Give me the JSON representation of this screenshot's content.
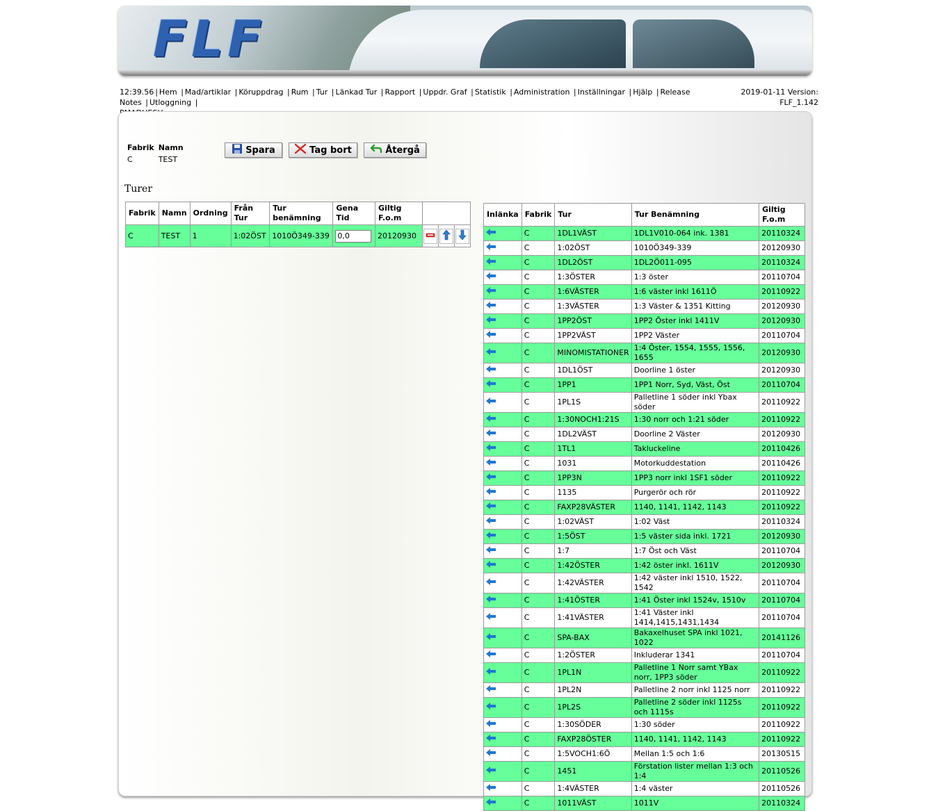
{
  "header": {
    "logo": "FLF"
  },
  "menu": {
    "time": "12:39.56",
    "items": [
      "Hem",
      "Mad/artiklar",
      "Köruppdrag",
      "Rum",
      "Tur",
      "Länkad Tur",
      "Rapport",
      "Uppdr. Graf",
      "Statistik",
      "Administration",
      "Inställningar",
      "Hjälp",
      "Release Notes",
      "Utloggning"
    ],
    "user": "PMADHESH",
    "date_version": "2019-01-11 Version:",
    "version": "FLF_1.142"
  },
  "info": {
    "fabrik_label": "Fabrik",
    "namn_label": "Namn",
    "fabrik": "C",
    "namn": "TEST"
  },
  "buttons": {
    "spara": "Spara",
    "tag_bort": "Tag bort",
    "atergå": "Återgå"
  },
  "turer_title": "Turer",
  "left_table": {
    "headers": [
      "Fabrik",
      "Namn",
      "Ordning",
      "Från Tur",
      "Tur benämning",
      "Gena Tid",
      "Giltig F.o.m"
    ],
    "row": {
      "fabrik": "C",
      "namn": "TEST",
      "ordning": "1",
      "fran_tur": "1:02ÖST",
      "tur_benamning": "1010Ö349-339",
      "gena_tid": "0,0",
      "giltig": "20120930"
    }
  },
  "right_table": {
    "headers": [
      "Inlänka",
      "Fabrik",
      "Tur",
      "Tur Benämning",
      "Giltig F.o.m"
    ],
    "rows": [
      {
        "fabrik": "C",
        "tur": "1DL1VÄST",
        "benamning": "1DL1V010-064 ink. 1381",
        "giltig": "20110324"
      },
      {
        "fabrik": "C",
        "tur": "1:02ÖST",
        "benamning": "1010Ö349-339",
        "giltig": "20120930"
      },
      {
        "fabrik": "C",
        "tur": "1DL2ÖST",
        "benamning": "1DL2Ö011-095",
        "giltig": "20110324"
      },
      {
        "fabrik": "C",
        "tur": "1:3ÖSTER",
        "benamning": "1:3 öster",
        "giltig": "20110704"
      },
      {
        "fabrik": "C",
        "tur": "1:6VÄSTER",
        "benamning": "1:6 väster inkl 1611Ö",
        "giltig": "20110922"
      },
      {
        "fabrik": "C",
        "tur": "1:3VÄSTER",
        "benamning": "1:3 Väster & 1351 Kitting",
        "giltig": "20120930"
      },
      {
        "fabrik": "C",
        "tur": "1PP2ÖST",
        "benamning": "1PP2 Öster inkl 1411V",
        "giltig": "20120930"
      },
      {
        "fabrik": "C",
        "tur": "1PP2VÄST",
        "benamning": "1PP2 Väster",
        "giltig": "20110704"
      },
      {
        "fabrik": "C",
        "tur": "MINOMISTATIONER",
        "benamning": "1:4 Öster, 1554, 1555, 1556, 1655",
        "giltig": "20120930"
      },
      {
        "fabrik": "C",
        "tur": "1DL1ÖST",
        "benamning": "Doorline 1 öster",
        "giltig": "20120930"
      },
      {
        "fabrik": "C",
        "tur": "1PP1",
        "benamning": "1PP1 Norr, Syd, Väst, Öst",
        "giltig": "20110704"
      },
      {
        "fabrik": "C",
        "tur": "1PL1S",
        "benamning": "Palletline 1 söder inkl Ybax söder",
        "giltig": "20110922"
      },
      {
        "fabrik": "C",
        "tur": "1:30NOCH1:21S",
        "benamning": "1:30 norr och 1:21 söder",
        "giltig": "20110922"
      },
      {
        "fabrik": "C",
        "tur": "1DL2VÄST",
        "benamning": "Doorline 2 Väster",
        "giltig": "20120930"
      },
      {
        "fabrik": "C",
        "tur": "1TL1",
        "benamning": "Takluckeline",
        "giltig": "20110426"
      },
      {
        "fabrik": "C",
        "tur": "1031",
        "benamning": "Motorkuddestation",
        "giltig": "20110426"
      },
      {
        "fabrik": "C",
        "tur": "1PP3N",
        "benamning": "1PP3 norr inkl 1SF1 söder",
        "giltig": "20110922"
      },
      {
        "fabrik": "C",
        "tur": "1135",
        "benamning": "Purgerör och rör",
        "giltig": "20110922"
      },
      {
        "fabrik": "C",
        "tur": "FAXP28VÄSTER",
        "benamning": "1140, 1141, 1142, 1143",
        "giltig": "20110922"
      },
      {
        "fabrik": "C",
        "tur": "1:02VÄST",
        "benamning": "1:02 Väst",
        "giltig": "20110324"
      },
      {
        "fabrik": "C",
        "tur": "1:5ÖST",
        "benamning": "1:5 väster sida inkl. 1721",
        "giltig": "20120930"
      },
      {
        "fabrik": "C",
        "tur": "1:7",
        "benamning": "1:7 Öst och Väst",
        "giltig": "20110704"
      },
      {
        "fabrik": "C",
        "tur": "1:42ÖSTER",
        "benamning": "1:42 öster inkl. 1611V",
        "giltig": "20120930"
      },
      {
        "fabrik": "C",
        "tur": "1:42VÄSTER",
        "benamning": "1:42 väster inkl 1510, 1522, 1542",
        "giltig": "20110704"
      },
      {
        "fabrik": "C",
        "tur": "1:41ÖSTER",
        "benamning": "1:41 Öster inkl 1524v, 1510v",
        "giltig": "20110704"
      },
      {
        "fabrik": "C",
        "tur": "1:41VÄSTER",
        "benamning": "1:41 Väster inkl 1414,1415,1431,1434",
        "giltig": "20110704"
      },
      {
        "fabrik": "C",
        "tur": "SPA-BAX",
        "benamning": "Bakaxelhuset SPA inkl 1021, 1022",
        "giltig": "20141126"
      },
      {
        "fabrik": "C",
        "tur": "1:2ÖSTER",
        "benamning": "Inkluderar 1341",
        "giltig": "20110704"
      },
      {
        "fabrik": "C",
        "tur": "1PL1N",
        "benamning": "Palletline 1 Norr samt YBax norr, 1PP3 söder",
        "giltig": "20110922"
      },
      {
        "fabrik": "C",
        "tur": "1PL2N",
        "benamning": "Palletline 2 norr inkl 1125 norr",
        "giltig": "20110922"
      },
      {
        "fabrik": "C",
        "tur": "1PL2S",
        "benamning": "Palletline 2 söder inkl 1125s och 1115s",
        "giltig": "20110922"
      },
      {
        "fabrik": "C",
        "tur": "1:30SÖDER",
        "benamning": "1:30 söder",
        "giltig": "20110922"
      },
      {
        "fabrik": "C",
        "tur": "FAXP28ÖSTER",
        "benamning": "1140, 1141, 1142, 1143",
        "giltig": "20110922"
      },
      {
        "fabrik": "C",
        "tur": "1:5VOCH1:6Ö",
        "benamning": "Mellan 1:5 och 1:6",
        "giltig": "20130515"
      },
      {
        "fabrik": "C",
        "tur": "1451",
        "benamning": "Förstation lister mellan 1:3 och 1:4",
        "giltig": "20110526"
      },
      {
        "fabrik": "C",
        "tur": "1:4VÄSTER",
        "benamning": "1:4 väster",
        "giltig": "20110526"
      },
      {
        "fabrik": "C",
        "tur": "1011VÄST",
        "benamning": "1011V",
        "giltig": "20110324"
      }
    ]
  }
}
